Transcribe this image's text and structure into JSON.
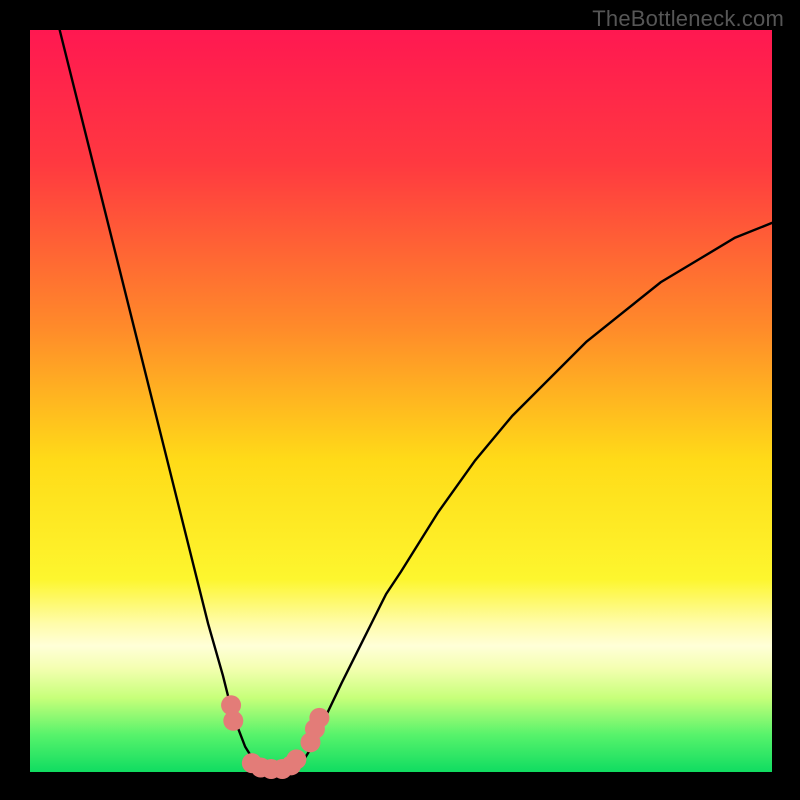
{
  "watermark": "TheBottleneck.com",
  "colors": {
    "frame": "#000000",
    "gradient_stops": [
      {
        "offset": 0.0,
        "color": "#ff1851"
      },
      {
        "offset": 0.18,
        "color": "#ff3940"
      },
      {
        "offset": 0.4,
        "color": "#ff8a2a"
      },
      {
        "offset": 0.58,
        "color": "#ffdb18"
      },
      {
        "offset": 0.74,
        "color": "#fdf62e"
      },
      {
        "offset": 0.8,
        "color": "#fffcaa"
      },
      {
        "offset": 0.83,
        "color": "#ffffd8"
      },
      {
        "offset": 0.86,
        "color": "#f4ffb1"
      },
      {
        "offset": 0.9,
        "color": "#c7ff7a"
      },
      {
        "offset": 0.95,
        "color": "#57f36b"
      },
      {
        "offset": 1.0,
        "color": "#10dc61"
      }
    ],
    "curve": "#000000",
    "markers": "#e37c78"
  },
  "chart_data": {
    "type": "line",
    "title": "",
    "xlabel": "",
    "ylabel": "",
    "xlim": [
      0,
      100
    ],
    "ylim": [
      0,
      100
    ],
    "x": [
      4,
      6,
      8,
      10,
      12,
      14,
      16,
      18,
      20,
      22,
      24,
      26,
      27,
      28,
      29,
      30,
      31,
      32,
      33,
      34,
      35,
      36,
      37,
      38,
      39,
      40,
      42,
      44,
      46,
      48,
      50,
      55,
      60,
      65,
      70,
      75,
      80,
      85,
      90,
      95,
      100
    ],
    "values": [
      100,
      92,
      84,
      76,
      68,
      60,
      52,
      44,
      36,
      28,
      20,
      13,
      9,
      6,
      3.4,
      1.8,
      0.8,
      0.3,
      0.1,
      0.1,
      0.3,
      0.8,
      1.8,
      3.4,
      5.4,
      7.8,
      12,
      16,
      20,
      24,
      27,
      35,
      42,
      48,
      53,
      58,
      62,
      66,
      69,
      72,
      74
    ],
    "markers": [
      {
        "x": 27.1,
        "y": 9.0
      },
      {
        "x": 27.4,
        "y": 6.9
      },
      {
        "x": 29.9,
        "y": 1.2
      },
      {
        "x": 31.1,
        "y": 0.6
      },
      {
        "x": 32.5,
        "y": 0.4
      },
      {
        "x": 34.0,
        "y": 0.4
      },
      {
        "x": 35.2,
        "y": 0.9
      },
      {
        "x": 35.9,
        "y": 1.7
      },
      {
        "x": 37.8,
        "y": 4.0
      },
      {
        "x": 38.4,
        "y": 5.8
      },
      {
        "x": 39.0,
        "y": 7.3
      }
    ]
  }
}
